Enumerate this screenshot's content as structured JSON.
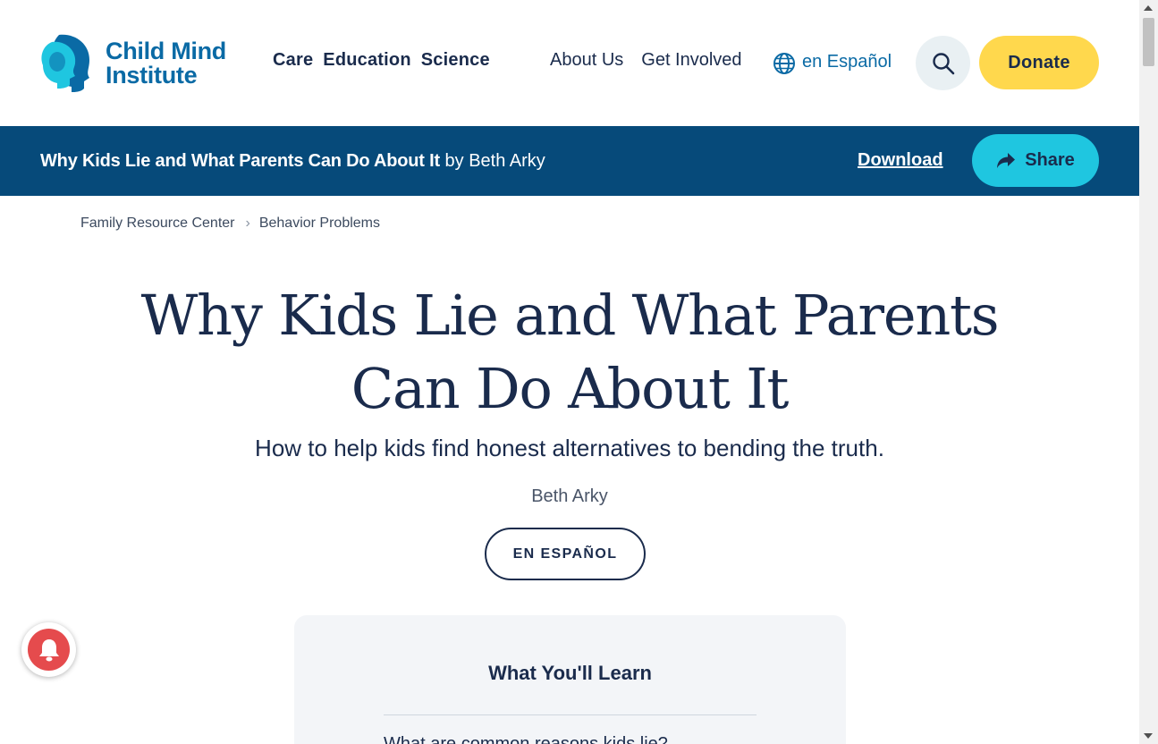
{
  "header": {
    "logo": {
      "line1": "Child Mind",
      "line2": "Institute",
      "icon": "child-mind-institute-heads-logo"
    },
    "primary_nav": [
      "Care",
      "Education",
      "Science"
    ],
    "secondary_nav": {
      "about": "About Us",
      "get_involved": "Get Involved"
    },
    "language": {
      "label": "en Español",
      "icon": "globe-icon"
    },
    "search": {
      "icon": "search-icon"
    },
    "donate": "Donate"
  },
  "article_bar": {
    "title": "Why Kids Lie and What Parents Can Do About It",
    "by": "by Beth Arky",
    "download": "Download",
    "share": "Share"
  },
  "breadcrumb": [
    "Family Resource Center",
    "Behavior Problems"
  ],
  "article": {
    "title": "Why Kids Lie and What Parents Can Do About It",
    "subtitle": "How to help kids find honest alternatives to bending the truth.",
    "author": "Beth Arky",
    "espanol_button": "EN ESPAÑOL"
  },
  "learn_box": {
    "title": "What You'll Learn",
    "first_item": "What are common reasons kids lie?"
  },
  "colors": {
    "navy": "#1a2b4c",
    "brand_blue": "#0a6aa5",
    "bar_blue": "#064a7a",
    "donate_yellow": "#ffd84d",
    "share_cyan": "#1fc6e0",
    "notify_red": "#e54b4d"
  }
}
